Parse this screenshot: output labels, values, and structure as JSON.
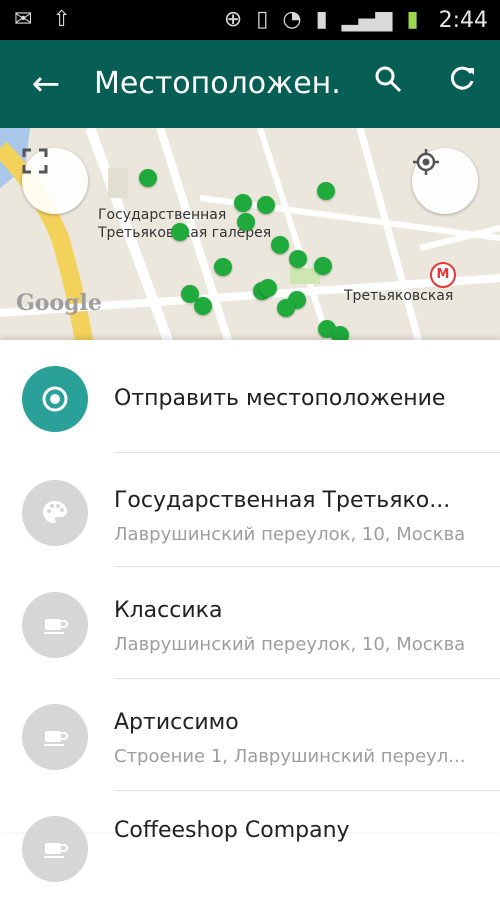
{
  "status_bar": {
    "time": "2:44",
    "icons": [
      "gmail-icon",
      "upload-icon",
      "gps-icon",
      "vibrate-icon",
      "wifi-icon",
      "sim-icon",
      "signal-icon",
      "battery-icon"
    ]
  },
  "app_bar": {
    "title": "Местоположен...",
    "back_icon": "arrow-back-icon",
    "search_icon": "search-icon",
    "refresh_icon": "refresh-icon",
    "color": "#075e54"
  },
  "map": {
    "labels": {
      "gallery": "Государственная\nТретьяковская галерея",
      "metro_station": "Третьяковская",
      "metro_symbol": "М",
      "google": "Google"
    },
    "fullscreen_icon": "fullscreen-icon",
    "my_location_icon": "my-location-icon",
    "marker_color": "#1faa3b"
  },
  "send_location": {
    "label": "Отправить местоположение",
    "accent": "#2aa198"
  },
  "places": [
    {
      "name": "Государственная Третьяко...",
      "address": "Лаврушинский переулок, 10, Москва",
      "icon": "palette-icon"
    },
    {
      "name": "Классика",
      "address": "Лаврушинский переулок, 10, Москва",
      "icon": "cafe-icon"
    },
    {
      "name": "Артиссимо",
      "address": "Строение 1, Лаврушинский переул...",
      "icon": "cafe-icon"
    },
    {
      "name": "Coffeeshop Company",
      "address": "",
      "icon": "cafe-icon"
    }
  ]
}
